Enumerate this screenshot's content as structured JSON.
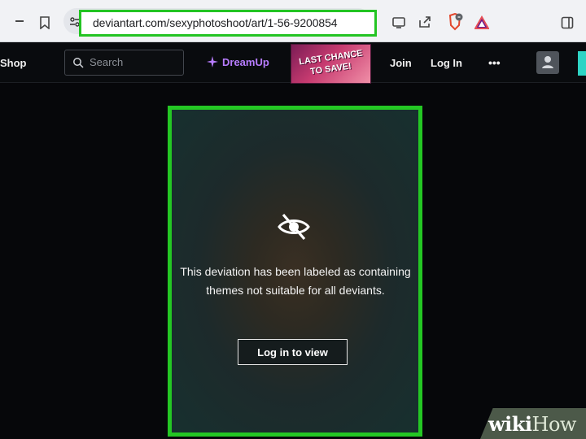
{
  "browser": {
    "url": "deviantart.com/sexyphotoshoot/art/1-56-9200854"
  },
  "site_header": {
    "shop_label": "Shop",
    "search_placeholder": "Search",
    "dreamup_label": "DreamUp",
    "promo_line1": "LAST CHANCE",
    "promo_line2": "TO SAVE!",
    "join_label": "Join",
    "login_label": "Log In",
    "more_label": "•••"
  },
  "content": {
    "notice": "This deviation has been labeled as containing themes not suitable for all deviants.",
    "button_label": "Log in to view"
  },
  "watermark": {
    "wiki": "wiki",
    "how": "How"
  },
  "colors": {
    "highlight": "#24c724",
    "dreamup": "#b77cff",
    "accent": "#2ed4c5"
  }
}
